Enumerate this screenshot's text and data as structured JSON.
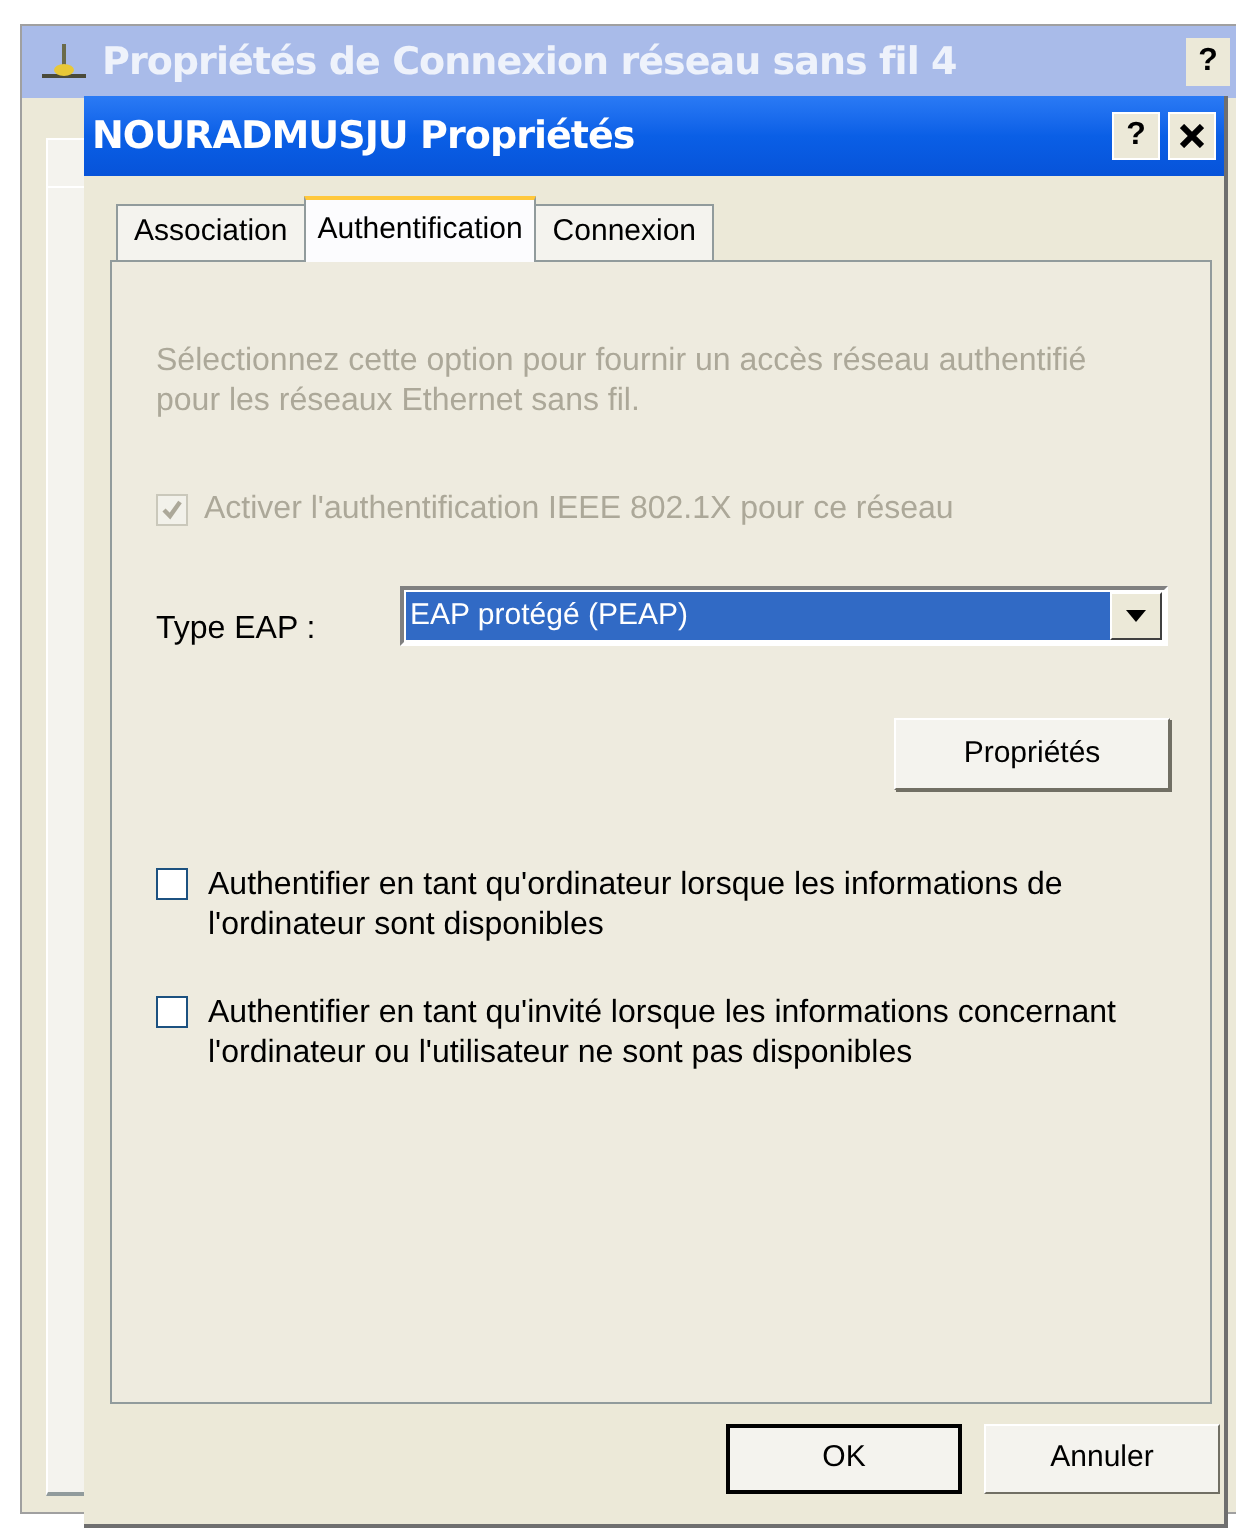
{
  "background_window": {
    "title": "Propriétés de Connexion réseau sans fil 4",
    "help_button": "?"
  },
  "dialog": {
    "title": "NOURADMUSJU Propriétés",
    "help_button": "?"
  },
  "tabs": [
    {
      "label": "Association",
      "selected": false
    },
    {
      "label": "Authentification",
      "selected": true
    },
    {
      "label": "Connexion",
      "selected": false
    }
  ],
  "description": "Sélectionnez cette option pour fournir un accès réseau authentifié pour les réseaux Ethernet sans fil.",
  "enable_option": {
    "label": "Activer l'authentification IEEE 802.1X pour ce réseau",
    "checked": true,
    "disabled": true
  },
  "eap_type": {
    "label": "Type EAP :",
    "value": "EAP protégé (PEAP)"
  },
  "properties_button": "Propriétés",
  "options": [
    {
      "label": "Authentifier en tant qu'ordinateur lorsque les informations de l'ordinateur sont disponibles",
      "checked": false
    },
    {
      "label": "Authentifier en tant qu'invité lorsque les informations concernant l'ordinateur ou l'utilisateur ne sont pas disponibles",
      "checked": false
    }
  ],
  "buttons": [
    {
      "label": "OK",
      "default": true
    },
    {
      "label": "Annuler",
      "default": false
    }
  ]
}
